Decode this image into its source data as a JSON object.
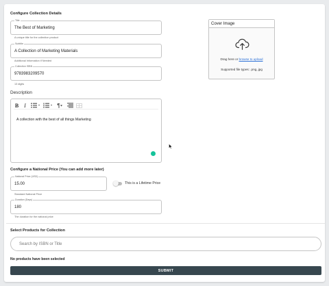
{
  "configure_collection": {
    "heading": "Configure Collection Details",
    "title_field": {
      "label": "Title",
      "value": "The Best of Marketing",
      "helper": "A unique title for the collection product"
    },
    "subtitle_field": {
      "label": "Subtitle",
      "value": "A Collection of Marketing Materials",
      "helper": "Additional Information if Needed"
    },
    "isbn_field": {
      "label": "Collection ISBN",
      "value": "9783983209570",
      "helper": "13 digits"
    }
  },
  "description": {
    "heading": "Description",
    "text": "A collection with the best of all things Marketing",
    "toolbar": {
      "bold": "B",
      "italic": "I",
      "bullet_list": "bullet-list-icon",
      "numbered_list": "numbered-list-icon",
      "paragraph": "¶",
      "align": "align-icon"
    }
  },
  "cover_image": {
    "title": "Cover Image",
    "drop_text": "Drag here or",
    "browse_link": "browse to upload",
    "supported": "Supported file types: .png,.jpg",
    "icon": "cloud-upload-icon"
  },
  "national_price": {
    "heading": "Configure a National Price (You can add more later)",
    "price_field": {
      "label": "National Price (USD)",
      "value": "15.00",
      "helper": "Standard National Price"
    },
    "lifetime_toggle": {
      "label": "This is a Lifetime Price",
      "on": false
    },
    "duration_field": {
      "label": "Duration (Days)",
      "value": "180",
      "helper": "The duration for the national price"
    }
  },
  "products": {
    "heading": "Select Products for Collection",
    "search_placeholder": "Search by ISBN or Title",
    "empty_text": "No products have been selected"
  },
  "submit_label": "SUBMIT",
  "colors": {
    "submit_bg": "#37474f",
    "link": "#2a6fd6",
    "grammarly": "#15c39a"
  }
}
